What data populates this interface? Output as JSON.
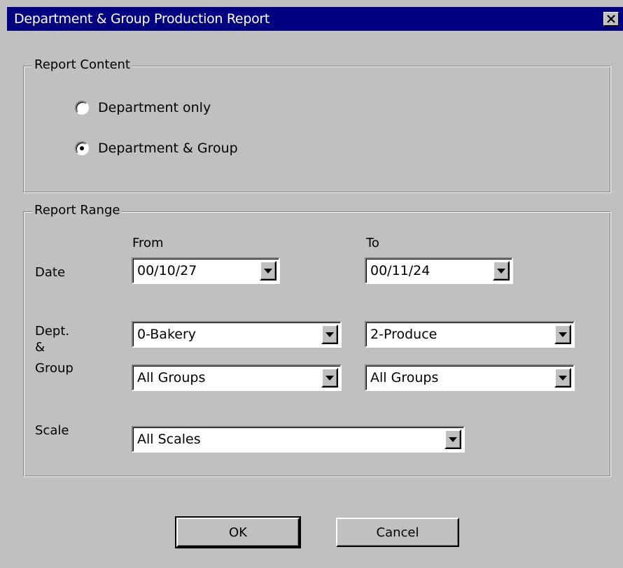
{
  "window": {
    "title": "Department & Group Production Report",
    "close_glyph": "✕"
  },
  "report_content": {
    "label": "Report Content",
    "options": [
      {
        "label": "Department only",
        "checked": false
      },
      {
        "label": "Department & Group",
        "checked": true
      }
    ]
  },
  "report_range": {
    "label": "Report Range",
    "from_label": "From",
    "to_label": "To",
    "date_label": "Date",
    "date_from": "00/10/27",
    "date_to": "00/11/24",
    "dept_label_1": "Dept.",
    "dept_label_2": "&",
    "dept_label_3": "Group",
    "dept_from": "0-Bakery",
    "dept_to": "2-Produce",
    "group_from": "All Groups",
    "group_to": "All Groups",
    "scale_label": "Scale",
    "scale": "All Scales"
  },
  "buttons": {
    "ok": "OK",
    "cancel": "Cancel"
  }
}
